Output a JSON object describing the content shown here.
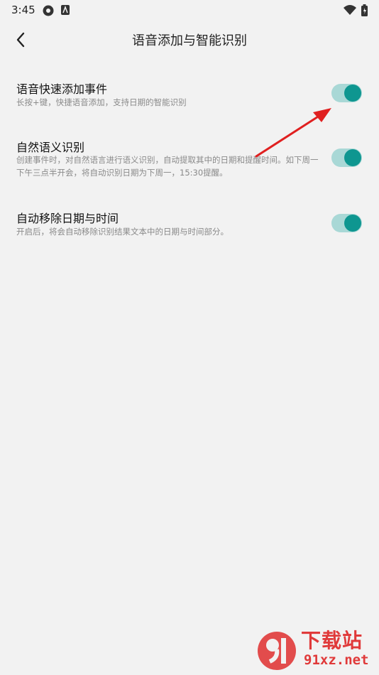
{
  "status_bar": {
    "time": "3:45"
  },
  "header": {
    "title": "语音添加与智能识别"
  },
  "settings": [
    {
      "title": "语音快速添加事件",
      "description": "长按+键，快捷语音添加，支持日期的智能识别",
      "enabled": true
    },
    {
      "title": "自然语义识别",
      "description": "创建事件时，对自然语言进行语义识别，自动提取其中的日期和提醒时间。如下周一下午三点半开会，将自动识别日期为下周一，15:30提醒。",
      "enabled": true
    },
    {
      "title": "自动移除日期与时间",
      "description": "开启后，将会自动移除识别结果文本中的日期与时间部分。",
      "enabled": true
    }
  ],
  "watermark": {
    "main_text": "下载站",
    "sub_text": "91xz.net"
  },
  "colors": {
    "accent": "#0e9690",
    "track": "#a9d8d6",
    "background": "#f2f2f2",
    "annotation_arrow": "#e02020",
    "watermark": "#e03a3a"
  }
}
